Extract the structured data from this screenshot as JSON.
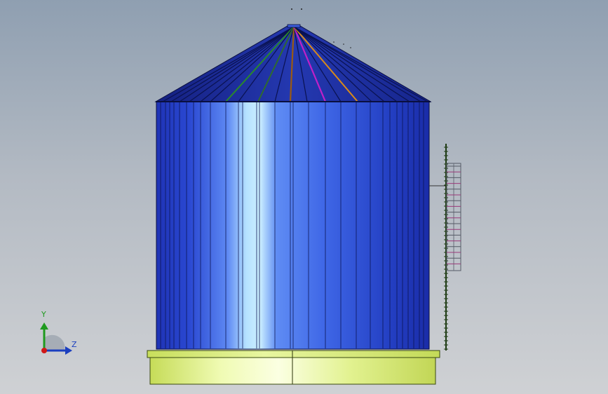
{
  "viewport": {
    "background_top": "#8f9fb1",
    "background_bottom": "#cfd1d4"
  },
  "model": {
    "silo_body_color": "#2f55dd",
    "silo_highlight_color": "#bfe8ff",
    "roof_color": "#1e2d9e",
    "base_color": "#dff28a",
    "roof_accent_colors": [
      "#2a8a2a",
      "#2f6a2f",
      "#9a5a12",
      "#c020c8",
      "#d98a1a"
    ]
  },
  "triad": {
    "y_label": "Y",
    "z_label": "Z",
    "y_color": "#1f9a1f",
    "z_color": "#1b3fbf",
    "x_color": "#d01818"
  }
}
